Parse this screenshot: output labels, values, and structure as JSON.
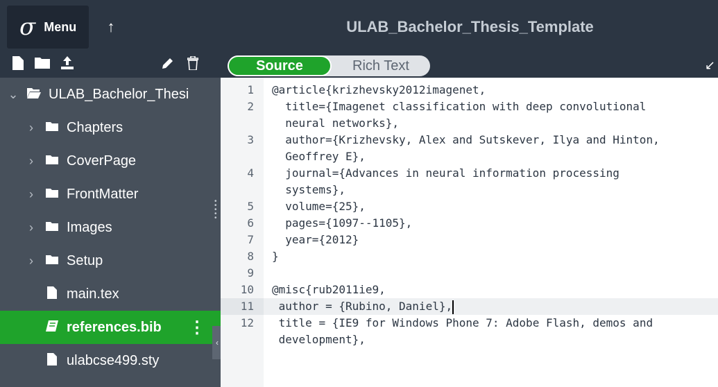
{
  "topbar": {
    "menu_label": "Menu",
    "logo_glyph": "σ",
    "up_icon": "↑",
    "project_title": "ULAB_Bachelor_Thesis_Template"
  },
  "sidebar": {
    "root_label": "ULAB_Bachelor_Thesi",
    "items": [
      {
        "label": "Chapters"
      },
      {
        "label": "CoverPage"
      },
      {
        "label": "FrontMatter"
      },
      {
        "label": "Images"
      },
      {
        "label": "Setup"
      },
      {
        "label": "main.tex"
      },
      {
        "label": "references.bib"
      },
      {
        "label": "ulabcse499.sty"
      }
    ]
  },
  "editor": {
    "toggle_source": "Source",
    "toggle_rich": "Rich Text",
    "lines": [
      {
        "n": "1",
        "t": "@article{krizhevsky2012imagenet,"
      },
      {
        "n": "2",
        "t": "  title={Imagenet classification with deep convolutional\n  neural networks},"
      },
      {
        "n": "3",
        "t": "  author={Krizhevsky, Alex and Sutskever, Ilya and Hinton,\n  Geoffrey E},"
      },
      {
        "n": "4",
        "t": "  journal={Advances in neural information processing\n  systems},"
      },
      {
        "n": "5",
        "t": "  volume={25},"
      },
      {
        "n": "6",
        "t": "  pages={1097--1105},"
      },
      {
        "n": "7",
        "t": "  year={2012}"
      },
      {
        "n": "8",
        "t": "}"
      },
      {
        "n": "9",
        "t": ""
      },
      {
        "n": "10",
        "t": "@misc{rub2011ie9,"
      },
      {
        "n": "11",
        "t": " author = {Rubino, Daniel},"
      },
      {
        "n": "12",
        "t": " title = {IE9 for Windows Phone 7: Adobe Flash, demos and\n development},"
      }
    ]
  },
  "colors": {
    "accent": "#1fa32b",
    "sidebar_bg": "#47505b",
    "topbar_bg": "#2c3643"
  }
}
